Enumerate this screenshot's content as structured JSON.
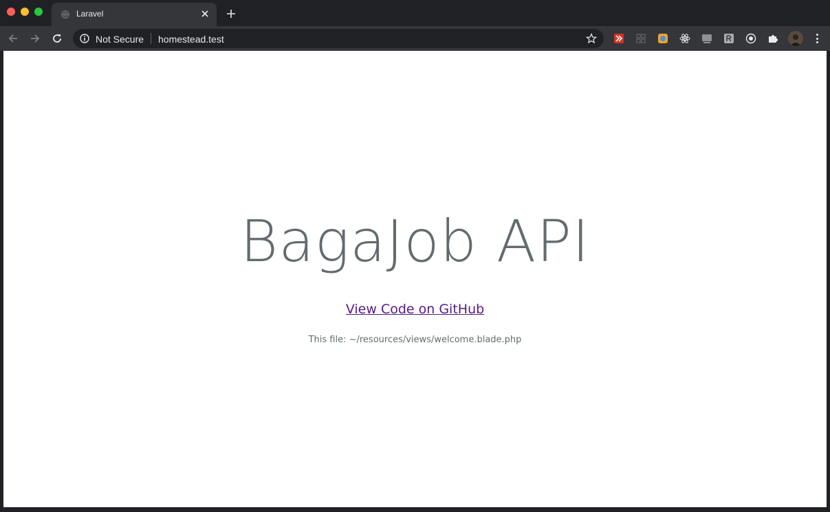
{
  "tab": {
    "title": "Laravel"
  },
  "omnibox": {
    "security_label": "Not Secure",
    "url": "homestead.test"
  },
  "page": {
    "heading": "BagaJob API",
    "link_text": "View Code on GitHub",
    "file_note": "This file: ~/resources/views/welcome.blade.php"
  },
  "extensions": [
    "vimium-icon",
    "grid-icon",
    "honey-icon",
    "react-devtools-icon",
    "css-peeper-icon",
    "readwise-icon",
    "target-icon",
    "puzzle-icon"
  ],
  "colors": {
    "link": "#551a8b",
    "heading": "#636b6f"
  }
}
